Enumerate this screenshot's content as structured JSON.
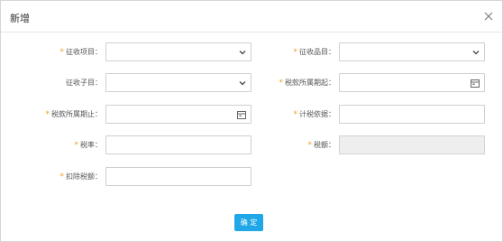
{
  "dialog": {
    "title": "新增",
    "close_glyph": "×"
  },
  "form": {
    "required_mark": "*",
    "fields": {
      "collection_item": {
        "label": "征收项目：",
        "required": true,
        "type": "select",
        "value": ""
      },
      "collection_category": {
        "label": "征收品目：",
        "required": true,
        "type": "select",
        "value": ""
      },
      "collection_subcategory": {
        "label": "征收子目：",
        "required": false,
        "type": "select",
        "value": ""
      },
      "tax_period_start": {
        "label": "税款所属期起：",
        "required": true,
        "type": "date",
        "value": ""
      },
      "tax_period_end": {
        "label": "税款所属期止：",
        "required": true,
        "type": "date",
        "value": ""
      },
      "tax_basis": {
        "label": "计税依据：",
        "required": true,
        "type": "text",
        "value": ""
      },
      "tax_rate": {
        "label": "税率：",
        "required": true,
        "type": "text",
        "value": ""
      },
      "tax_amount": {
        "label": "税额：",
        "required": true,
        "type": "text",
        "value": "",
        "disabled": true
      },
      "deduction_amount": {
        "label": "扣除税额：",
        "required": true,
        "type": "text",
        "value": ""
      }
    }
  },
  "footer": {
    "confirm_label": "确 定"
  },
  "colors": {
    "accent": "#1fa7e8",
    "required": "#f0a020",
    "disabled_bg": "#eeeeee"
  },
  "icons": [
    "close-icon",
    "chevron-down-icon",
    "calendar-icon"
  ]
}
